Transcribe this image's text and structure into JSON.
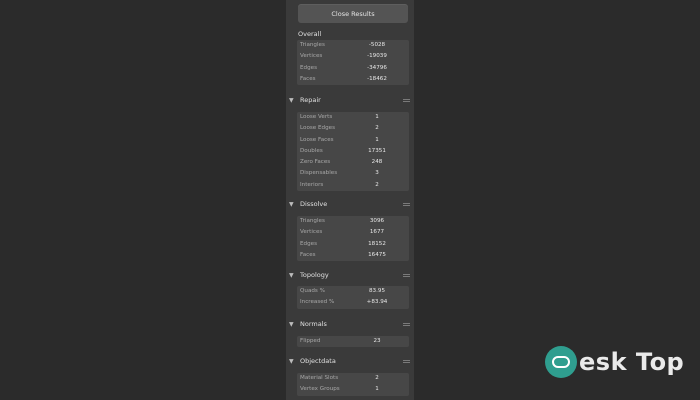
{
  "close_button": "Close Results",
  "overall": {
    "title": "Overall",
    "rows": [
      {
        "k": "Triangles",
        "v": "-5028"
      },
      {
        "k": "Vertices",
        "v": "-19039"
      },
      {
        "k": "Edges",
        "v": "-34796"
      },
      {
        "k": "Faces",
        "v": "-18462"
      }
    ]
  },
  "repair": {
    "title": "Repair",
    "rows": [
      {
        "k": "Loose Verts",
        "v": "1"
      },
      {
        "k": "Loose Edges",
        "v": "2"
      },
      {
        "k": "Loose Faces",
        "v": "1"
      },
      {
        "k": "Doubles",
        "v": "17351"
      },
      {
        "k": "Zero Faces",
        "v": "248"
      },
      {
        "k": "Dispensables",
        "v": "3"
      },
      {
        "k": "Interiors",
        "v": "2"
      }
    ]
  },
  "dissolve": {
    "title": "Dissolve",
    "rows": [
      {
        "k": "Triangles",
        "v": "3096"
      },
      {
        "k": "Vertices",
        "v": "1677"
      },
      {
        "k": "Edges",
        "v": "18152"
      },
      {
        "k": "Faces",
        "v": "16475"
      }
    ]
  },
  "topology": {
    "title": "Topology",
    "rows": [
      {
        "k": "Quads %",
        "v": "83.95"
      },
      {
        "k": "Increased %",
        "v": "+83.94"
      }
    ]
  },
  "normals": {
    "title": "Normals",
    "rows": [
      {
        "k": "Flipped",
        "v": "23"
      }
    ]
  },
  "objectdata": {
    "title": "Objectdata",
    "rows": [
      {
        "k": "Material Slots",
        "v": "2"
      },
      {
        "k": "Vertex Groups",
        "v": "1"
      }
    ]
  },
  "watermark": "esk Top",
  "colors": {
    "accent": "#2f9e8f",
    "panel": "#3a3a3a",
    "background": "#2b2b2b"
  }
}
